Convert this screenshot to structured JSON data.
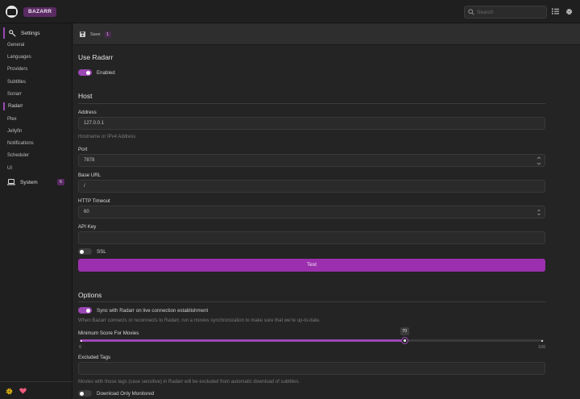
{
  "header": {
    "brand": "BAZARR",
    "search_placeholder": "Search"
  },
  "toolbar": {
    "save_label": "Save",
    "save_count": "1"
  },
  "sidebar": {
    "settings_label": "Settings",
    "items": [
      "General",
      "Languages",
      "Providers",
      "Subtitles",
      "Sonarr",
      "Radarr",
      "Plex",
      "Jellyfin",
      "Notifications",
      "Scheduler",
      "UI"
    ],
    "selected": "Radarr",
    "system_label": "System",
    "system_badge": "6"
  },
  "main": {
    "use_radarr": {
      "title": "Use Radarr",
      "enabled_label": "Enabled",
      "enabled": true
    },
    "host": {
      "title": "Host",
      "address_label": "Address",
      "address_value": "127.0.0.1",
      "address_hint": "Hostname or IPv4 Address",
      "port_label": "Port",
      "port_value": "7878",
      "base_url_label": "Base URL",
      "base_url_value": "/",
      "timeout_label": "HTTP Timeout",
      "timeout_value": "60",
      "api_key_label": "API Key",
      "api_key_value": "",
      "ssl_label": "SSL",
      "ssl": false,
      "test_label": "Test"
    },
    "options": {
      "title": "Options",
      "sync_label": "Sync with Radarr on live connection establishment",
      "sync": true,
      "sync_hint": "When Bazarr connects or reconnects to Radarr, run a movies synchronization to make sure that we're up-to-date.",
      "min_score_label": "Minimum Score For Movies",
      "min_score_value": "70",
      "min_score_min": "0",
      "min_score_max": "100",
      "min_score_fraction": 0.7,
      "excluded_tags_label": "Excluded Tags",
      "excluded_tags_value": "",
      "excluded_tags_hint": "Movies with those tags (case sensitive) in Radarr will be excluded from automatic download of subtitles.",
      "download_monitored_label": "Download Only Monitored",
      "download_monitored": false
    }
  },
  "colors": {
    "accent": "#9b47b5",
    "button": "#9b2fae",
    "brand_bg": "#5a2a63",
    "footer_gear": "#f4c20d",
    "footer_heart": "#f05a7e"
  }
}
